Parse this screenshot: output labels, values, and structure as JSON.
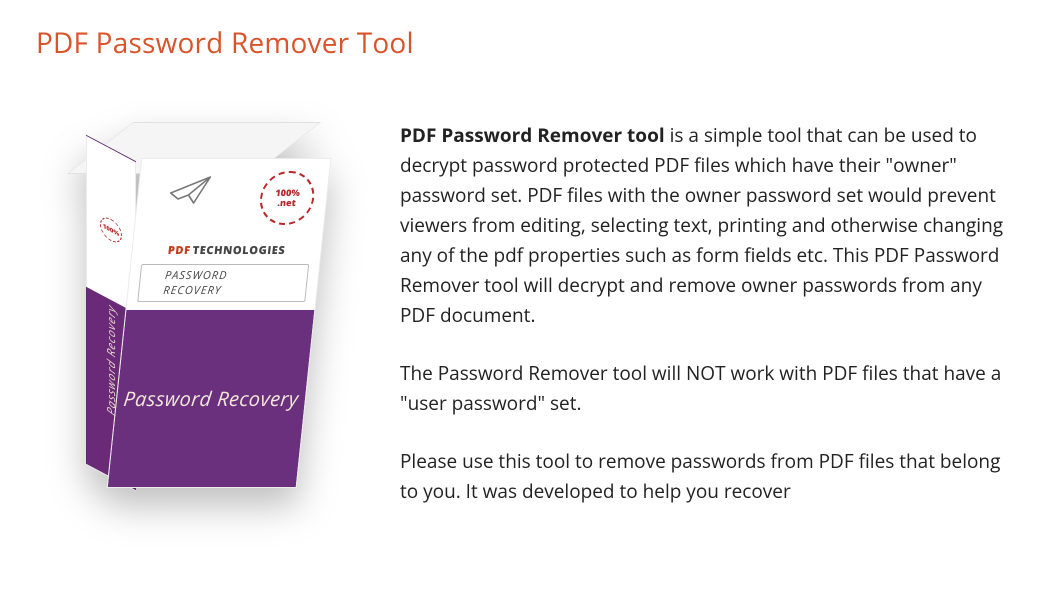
{
  "title": "PDF Password Remover Tool",
  "product_box": {
    "brand_pdf": "PDF",
    "brand_tech": "TECHNOLOGIES",
    "sub_brand": "PASSWORD RECOVERY",
    "front_label": "Password Recovery",
    "spine_label": "Password Recovery",
    "badge_top": "100%",
    "badge_bottom": ".net"
  },
  "body": {
    "p1_lead": "PDF Password Remover tool",
    "p1_rest": " is a simple tool that can be used to decrypt password protected PDF files which have their \"owner\" password set. PDF files with the owner password set would prevent viewers from editing, selecting text, printing and otherwise changing any of the pdf properties such as form fields etc. This PDF Password Remover tool will decrypt and remove owner passwords from any PDF document.",
    "p2": "The Password Remover tool will NOT work with PDF files that have a \"user password\" set.",
    "p3": "Please use this tool to remove passwords from PDF files that belong to you. It was developed to help you recover"
  }
}
